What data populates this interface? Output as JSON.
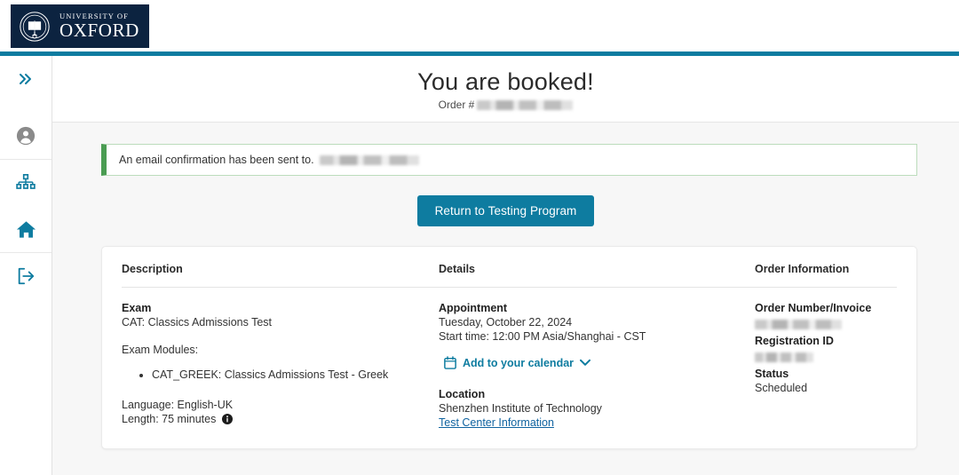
{
  "brand": {
    "line1": "UNIVERSITY OF",
    "line2": "OXFORD",
    "crest_icon": "oxford-crest-icon",
    "accent_teal": "#0e7ca0",
    "navy": "#0c2340"
  },
  "sidebar": {
    "items": [
      {
        "name": "expand-sidebar",
        "icon": "chevron-double-right-icon",
        "label": "»"
      },
      {
        "name": "account",
        "icon": "user-circle-icon",
        "label": ""
      },
      {
        "name": "org-chart",
        "icon": "sitemap-icon",
        "label": ""
      },
      {
        "name": "home",
        "icon": "home-icon",
        "label": ""
      },
      {
        "name": "sign-out",
        "icon": "sign-out-icon",
        "label": ""
      }
    ]
  },
  "header": {
    "title": "You are booked!",
    "order_label": "Order #",
    "order_value_redacted": true
  },
  "alert": {
    "message": "An email confirmation has been sent to.",
    "email_redacted": true,
    "border_color": "#4a9c52"
  },
  "actions": {
    "return_button": "Return to Testing Program"
  },
  "card": {
    "columns": [
      {
        "header": "Description"
      },
      {
        "header": "Details"
      },
      {
        "header": "Order Information"
      }
    ],
    "description": {
      "exam_label": "Exam",
      "exam_value": "CAT: Classics Admissions Test",
      "modules_label": "Exam Modules:",
      "modules": [
        "CAT_GREEK: Classics Admissions Test - Greek"
      ],
      "language": "Language: English-UK",
      "length": "Length: 75 minutes",
      "length_info_icon": "info-circle-icon"
    },
    "details": {
      "appointment_label": "Appointment",
      "appointment_date": "Tuesday, October 22, 2024",
      "appointment_time": "Start time: 12:00 PM Asia/Shanghai - CST",
      "calendar_link": "Add to your calendar",
      "calendar_icon": "calendar-icon",
      "calendar_chevron": "chevron-down-icon",
      "location_label": "Location",
      "location_value": "Shenzhen Institute of Technology",
      "test_center_link": "Test Center Information"
    },
    "order": {
      "order_number_label": "Order Number/Invoice",
      "order_number_redacted": true,
      "registration_id_label": "Registration ID",
      "registration_id_redacted": true,
      "status_label": "Status",
      "status_value": "Scheduled"
    }
  }
}
